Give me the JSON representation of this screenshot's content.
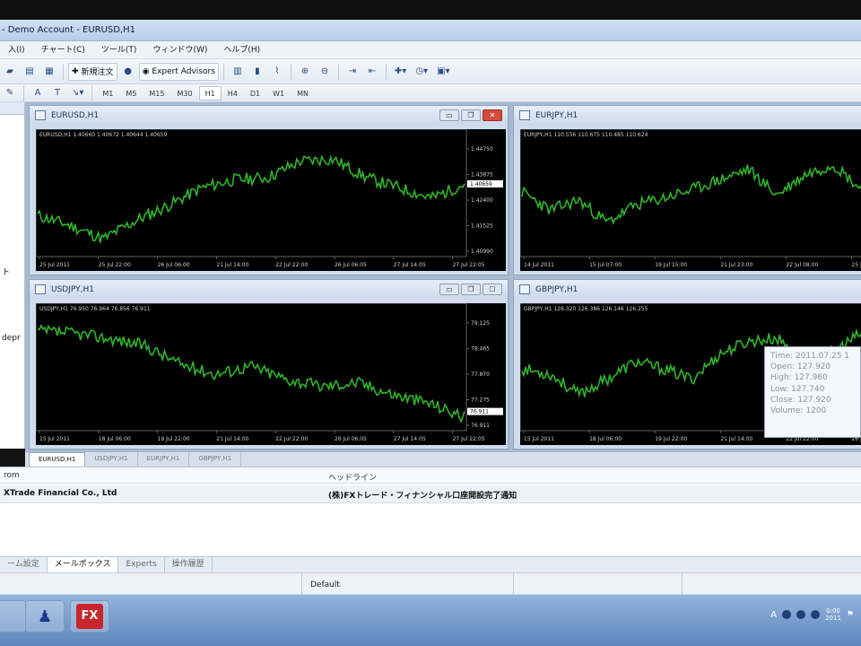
{
  "title": "- Demo Account - EURUSD,H1",
  "menu": [
    "入(I)",
    "チャート(C)",
    "ツール(T)",
    "ウィンドウ(W)",
    "ヘルプ(H)"
  ],
  "toolbar": {
    "new_order": "新規注文",
    "expert_advisors": "Expert Advisors"
  },
  "timeframes": [
    "M1",
    "M5",
    "M15",
    "M30",
    "H1",
    "H4",
    "D1",
    "W1",
    "MN"
  ],
  "active_timeframe": "H1",
  "left_panel": {
    "label1": "ト",
    "label2": "depr"
  },
  "charts": [
    {
      "id": "eurusd",
      "title": "EURUSD,H1",
      "ohlc": "EURUSD,H1  1.40660 1.40672 1.40644 1.40659",
      "yticks": [
        "1.44750",
        "1.43875",
        "1.42400",
        "1.41525",
        "1.40990"
      ],
      "current_price": "1.40659",
      "xticks": [
        "25 Jul 2011",
        "25 Jul 22:00",
        "26 Jul 06:00",
        "21 Jul 14:00",
        "22 Jul 22:00",
        "26 Jul 06:05",
        "27 Jul 14:05",
        "27 Jul 22:05"
      ]
    },
    {
      "id": "eurjpy",
      "title": "EURJPY,H1",
      "ohlc": "EURJPY,H1  110.556 110.675 110.485 110.624",
      "yticks": [],
      "xticks": [
        "14 Jul 2011",
        "15 Jul 07:00",
        "19 Jul 15:00",
        "21 Jul 23:00",
        "22 Jul 08:00",
        "25 Jul"
      ]
    },
    {
      "id": "usdjpy",
      "title": "USDJPY,H1",
      "ohlc": "USDJPY,H1  76.950 76.964 76.856 76.911",
      "yticks": [
        "79.125",
        "78.465",
        "77.870",
        "77.275",
        "76.911"
      ],
      "current_price": "76.911",
      "xticks": [
        "15 Jul 2011",
        "18 Jul 06:00",
        "19 Jul 22:00",
        "21 Jul 14:00",
        "22 Jul 22:00",
        "26 Jul 06:05",
        "27 Jul 14:05",
        "27 Jul 22:05"
      ]
    },
    {
      "id": "gbpjpy",
      "title": "GBPJPY,H1",
      "ohlc": "GBPJPY,H1  126.320 126.386 126.146 126.255",
      "yticks": [],
      "xticks": [
        "15 Jul 2011",
        "18 Jul 06:00",
        "19 Jul 22:00",
        "21 Jul 14:00",
        "22 Jul 22:00",
        "26 Jul"
      ]
    }
  ],
  "tooltip": {
    "time": "Time: 2011.07.25 1",
    "open": "Open: 127.920",
    "high": "High: 127.960",
    "low": "Low:  127.740",
    "close": "Close: 127.920",
    "volume": "Volume: 1200"
  },
  "chart_tabs": [
    "EURUSD,H1",
    "USDJPY,H1",
    "EURJPY,H1",
    "GBPJPY,H1"
  ],
  "mailbox": {
    "col_from": "rom",
    "col_headline": "ヘッドライン",
    "row_from": "XTrade Financial Co., Ltd",
    "row_headline": "(株)FXトレード・フィナンシャル口座開設完了通知"
  },
  "bottom_tabs": [
    "ーム設定",
    "メールボックス",
    "Experts",
    "操作履歴"
  ],
  "status": {
    "profile": "Default"
  },
  "taskbar": {
    "fx_label": "FX"
  },
  "tray": {
    "clock_time": "0:00",
    "clock_date": "2011"
  },
  "colors": {
    "price_line": "#2fb52a",
    "chart_bg": "#000000",
    "grid": "#5f5f5f"
  }
}
